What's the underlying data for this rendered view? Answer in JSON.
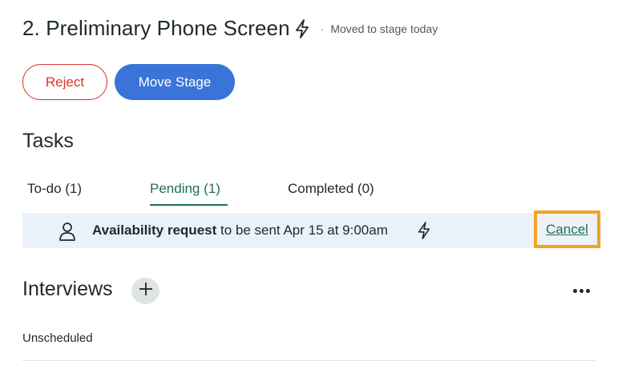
{
  "stage": {
    "title": "2. Preliminary Phone Screen",
    "separator": "·",
    "moved_text": "Moved to stage today"
  },
  "actions": {
    "reject_label": "Reject",
    "move_stage_label": "Move Stage"
  },
  "tasks": {
    "title": "Tasks",
    "tabs": [
      {
        "label": "To-do (1)",
        "active": false
      },
      {
        "label": "Pending (1)",
        "active": true
      },
      {
        "label": "Completed (0)",
        "active": false
      }
    ],
    "pending_item": {
      "name": "Availability request",
      "detail": " to be sent Apr 15 at 9:00am",
      "cancel_label": "Cancel"
    }
  },
  "interviews": {
    "title": "Interviews",
    "status": "Unscheduled"
  },
  "colors": {
    "accent_green": "#1e6f55",
    "primary_blue": "#3a74d8",
    "reject_red": "#d9362b",
    "highlight_orange": "#f5a123",
    "row_bg": "#ebf1fa"
  },
  "icons": [
    "lightning-icon",
    "person-icon",
    "plus-icon",
    "more-icon"
  ]
}
